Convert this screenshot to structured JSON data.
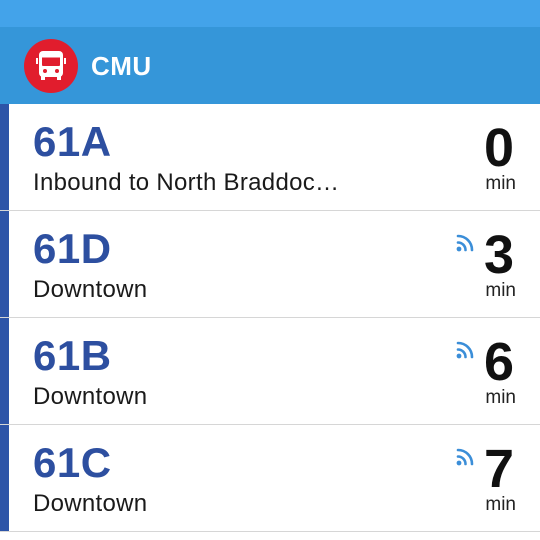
{
  "header": {
    "stop_name": "CMU",
    "icon": "bus-icon",
    "colors": {
      "status_bar": "#43a3ea",
      "header_bg": "#3596d9",
      "icon_bg": "#e11d2d",
      "route_text": "#2d4fa0"
    }
  },
  "arrivals": [
    {
      "route": "61A",
      "destination": "Inbound to North Braddoc…",
      "minutes": "0",
      "unit": "min",
      "realtime": false
    },
    {
      "route": "61D",
      "destination": "Downtown",
      "minutes": "3",
      "unit": "min",
      "realtime": true
    },
    {
      "route": "61B",
      "destination": "Downtown",
      "minutes": "6",
      "unit": "min",
      "realtime": true
    },
    {
      "route": "61C",
      "destination": "Downtown",
      "minutes": "7",
      "unit": "min",
      "realtime": true
    }
  ]
}
